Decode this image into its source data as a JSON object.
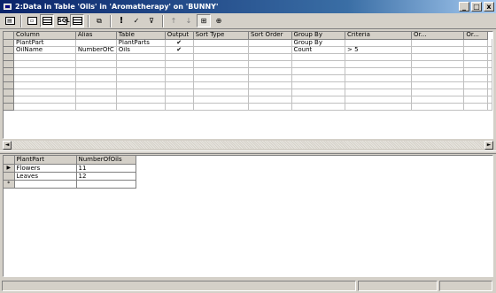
{
  "window": {
    "title": "2:Data in Table 'Oils' in 'Aromatherapy' on 'BUNNY'",
    "caption_buttons": [
      "_",
      "□",
      "x"
    ]
  },
  "toolbar": {
    "buttons": [
      {
        "name": "properties-button"
      },
      {
        "name": "show-diagram-pane-button"
      },
      {
        "name": "show-grid-pane-button",
        "pressed": true
      },
      {
        "name": "show-sql-pane-button",
        "label": "SQL"
      },
      {
        "name": "show-results-pane-button",
        "pressed": true
      },
      {
        "name": "change-query-type-button"
      },
      {
        "name": "run-button",
        "label": "!"
      },
      {
        "name": "verify-sql-button"
      },
      {
        "name": "remove-filter-button"
      },
      {
        "name": "sort-ascending-button"
      },
      {
        "name": "sort-descending-button"
      },
      {
        "name": "use-group-by-button",
        "pressed": true
      },
      {
        "name": "add-table-button"
      }
    ]
  },
  "query_grid": {
    "columns": [
      "Column",
      "Alias",
      "Table",
      "Output",
      "Sort Type",
      "Sort Order",
      "Group By",
      "Criteria",
      "Or...",
      "Or..."
    ],
    "rows": [
      [
        "PlantPart",
        "",
        "PlantParts",
        "✔",
        "",
        "",
        "Group By",
        "",
        "",
        ""
      ],
      [
        "OilName",
        "NumberOfC",
        "Oils",
        "✔",
        "",
        "",
        "Count",
        "> 5",
        "",
        ""
      ],
      [
        "",
        "",
        "",
        "",
        "",
        "",
        "",
        "",
        "",
        ""
      ],
      [
        "",
        "",
        "",
        "",
        "",
        "",
        "",
        "",
        "",
        ""
      ],
      [
        "",
        "",
        "",
        "",
        "",
        "",
        "",
        "",
        "",
        ""
      ],
      [
        "",
        "",
        "",
        "",
        "",
        "",
        "",
        "",
        "",
        ""
      ],
      [
        "",
        "",
        "",
        "",
        "",
        "",
        "",
        "",
        "",
        ""
      ],
      [
        "",
        "",
        "",
        "",
        "",
        "",
        "",
        "",
        "",
        ""
      ],
      [
        "",
        "",
        "",
        "",
        "",
        "",
        "",
        "",
        "",
        ""
      ],
      [
        "",
        "",
        "",
        "",
        "",
        "",
        "",
        "",
        "",
        ""
      ]
    ]
  },
  "results_grid": {
    "columns": [
      "PlantPart",
      "NumberOfOils"
    ],
    "rows": [
      {
        "marker": "▶",
        "cells": [
          "Flowers",
          "11"
        ]
      },
      {
        "marker": "",
        "cells": [
          "Leaves",
          "12"
        ]
      },
      {
        "marker": "*",
        "cells": [
          "",
          ""
        ]
      }
    ]
  },
  "scrollbar": {
    "left_arrow": "◄",
    "right_arrow": "►"
  }
}
